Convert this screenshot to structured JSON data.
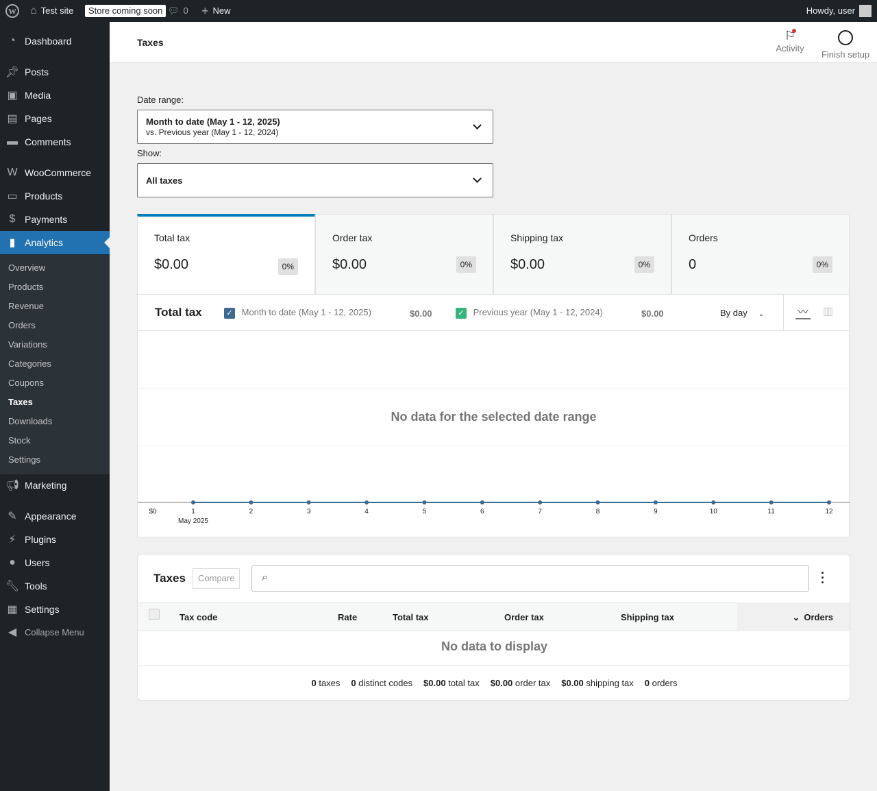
{
  "adminbar": {
    "site": "Test site",
    "badge": "Store coming soon",
    "comments": "0",
    "new": "New",
    "howdy": "Howdy, user"
  },
  "sidebar": {
    "items": [
      {
        "label": "Dashboard",
        "icon": "dashboard-icon"
      },
      {
        "label": "Posts",
        "icon": "pin-icon"
      },
      {
        "label": "Media",
        "icon": "media-icon"
      },
      {
        "label": "Pages",
        "icon": "pages-icon"
      },
      {
        "label": "Comments",
        "icon": "comment-icon"
      },
      {
        "label": "WooCommerce",
        "icon": "woo-icon"
      },
      {
        "label": "Products",
        "icon": "archive-icon"
      },
      {
        "label": "Payments",
        "icon": "dollar-icon"
      },
      {
        "label": "Analytics",
        "icon": "chart-icon"
      },
      {
        "label": "Marketing",
        "icon": "megaphone-icon"
      },
      {
        "label": "Appearance",
        "icon": "brush-icon"
      },
      {
        "label": "Plugins",
        "icon": "plug-icon"
      },
      {
        "label": "Users",
        "icon": "user-icon"
      },
      {
        "label": "Tools",
        "icon": "wrench-icon"
      },
      {
        "label": "Settings",
        "icon": "settings-icon"
      },
      {
        "label": "Collapse Menu",
        "icon": "collapse-icon"
      }
    ],
    "submenu": [
      "Overview",
      "Products",
      "Revenue",
      "Orders",
      "Variations",
      "Categories",
      "Coupons",
      "Taxes",
      "Downloads",
      "Stock",
      "Settings"
    ]
  },
  "header": {
    "title": "Taxes",
    "activity": "Activity",
    "finish": "Finish setup"
  },
  "filters": {
    "date_label": "Date range:",
    "date_main": "Month to date (May 1 - 12, 2025)",
    "date_compare": "vs. Previous year (May 1 - 12, 2024)",
    "show_label": "Show:",
    "show_value": "All taxes"
  },
  "cards": [
    {
      "title": "Total tax",
      "value": "$0.00",
      "delta": "0%"
    },
    {
      "title": "Order tax",
      "value": "$0.00",
      "delta": "0%"
    },
    {
      "title": "Shipping tax",
      "value": "$0.00",
      "delta": "0%"
    },
    {
      "title": "Orders",
      "value": "0",
      "delta": "0%"
    }
  ],
  "chart": {
    "title": "Total tax",
    "legend": [
      {
        "label": "Month to date (May 1 - 12, 2025)",
        "total": "$0.00",
        "color": "#3d6a8e"
      },
      {
        "label": "Previous year (May 1 - 12, 2024)",
        "total": "$0.00",
        "color": "#37b37c"
      }
    ],
    "interval": "By day",
    "empty": "No data for the selected date range"
  },
  "chart_data": {
    "type": "line",
    "x": [
      "1",
      "2",
      "3",
      "4",
      "5",
      "6",
      "7",
      "8",
      "9",
      "10",
      "11",
      "12"
    ],
    "x_sublabel": "May 2025",
    "y_tick": "$0",
    "series": [
      {
        "name": "Month to date (May 1 - 12, 2025)",
        "values": [
          0,
          0,
          0,
          0,
          0,
          0,
          0,
          0,
          0,
          0,
          0,
          0
        ]
      }
    ]
  },
  "table": {
    "title": "Taxes",
    "compare": "Compare",
    "search_placeholder": "",
    "columns": [
      "Tax code",
      "Rate",
      "Total tax",
      "Order tax",
      "Shipping tax",
      "Orders"
    ],
    "empty": "No data to display",
    "summary": [
      {
        "v": "0",
        "l": "taxes"
      },
      {
        "v": "0",
        "l": "distinct codes"
      },
      {
        "v": "$0.00",
        "l": "total tax"
      },
      {
        "v": "$0.00",
        "l": "order tax"
      },
      {
        "v": "$0.00",
        "l": "shipping tax"
      },
      {
        "v": "0",
        "l": "orders"
      }
    ]
  }
}
